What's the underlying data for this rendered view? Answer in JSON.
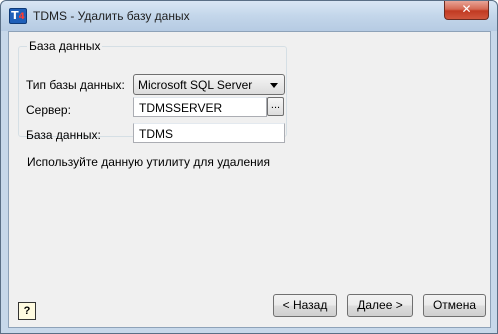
{
  "window": {
    "title": "TDMS - Удалить базу даных",
    "icon": {
      "name": "tdms-app-icon",
      "main": "T",
      "sub": "4"
    },
    "close_glyph": "✕"
  },
  "group": {
    "title": "База данных",
    "db_type_label": "Тип базы данных:",
    "db_type_value": "Microsoft SQL Server",
    "server_label": "Сервер:",
    "server_value": "TDMSSERVER",
    "browse_label": "...",
    "database_label": "База данных:",
    "database_value": "TDMS"
  },
  "info_text": "Используйте данную утилиту для удаления",
  "help_glyph": "?",
  "buttons": {
    "back": "< Назад",
    "next": "Далее >",
    "cancel": "Отмена"
  }
}
